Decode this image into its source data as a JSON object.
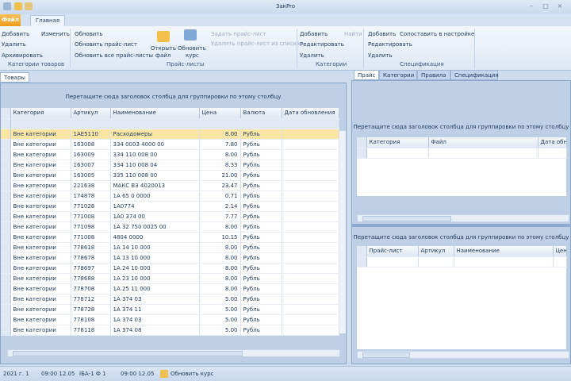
{
  "window": {
    "title": "ЗакPro"
  },
  "ribbon": {
    "app_button": "Файл",
    "tab": "Главная",
    "group1": {
      "items": [
        "Добавить",
        "Изменить",
        "Удалить",
        "Архивировать"
      ],
      "label": "Категории товаров"
    },
    "group2": {
      "items": [
        "Обновить",
        "Обновить прайс-лист",
        "Обновить все прайс-листы"
      ],
      "label": "Прайс-листы"
    },
    "group3": {
      "open": "Открыть",
      "open_sub": "файл",
      "refresh": "Обновить",
      "refresh_sub": "курс",
      "dis1": "Задать прайс-лист",
      "dis2": "Удалить прайс-лист из списка",
      "label": "Прайс-листы"
    },
    "group4": {
      "items": [
        "Добавить",
        "Редактировать",
        "Удалить"
      ],
      "extra": "Найти",
      "label": "Категории"
    },
    "group5": {
      "items": [
        "Добавить",
        "Редактировать",
        "Удалить"
      ],
      "extra": "Сопоставить в настройке",
      "label": "Спецификация"
    }
  },
  "left_panel": {
    "tab": "Товары",
    "group_hint": "Перетащите сюда заголовок столбца для группировки по этому столбцу",
    "columns": [
      "Категория",
      "Артикул",
      "Наименование",
      "Цена",
      "Валюта",
      "Дата обновления"
    ],
    "rows": [
      [
        "Вне категории",
        "1АЕ5110",
        "Расходомеры",
        "8.00",
        "Рубль",
        ""
      ],
      [
        "Вне категории",
        "163008",
        "334 0003 4000 00",
        "7.80",
        "Рубль",
        ""
      ],
      [
        "Вне категории",
        "163009",
        "334 110 008 00",
        "8.00",
        "Рубль",
        ""
      ],
      [
        "Вне категории",
        "163007",
        "334 110 008 04",
        "8.33",
        "Рубль",
        ""
      ],
      [
        "Вне категории",
        "163005",
        "335 110 008 00",
        "21.00",
        "Рубль",
        ""
      ],
      [
        "Вне категории",
        "221638",
        "МАКС ВЗ 4020013",
        "23.47",
        "Рубль",
        ""
      ],
      [
        "Вне категории",
        "174878",
        "1А 65 0 0000",
        "0.71",
        "Рубль",
        ""
      ],
      [
        "Вне категории",
        "771028",
        "1А0774",
        "2.14",
        "Рубль",
        ""
      ],
      [
        "Вне категории",
        "771008",
        "1А0 374 00",
        "7.77",
        "Рубль",
        ""
      ],
      [
        "Вне категории",
        "771098",
        "1А 32 750 0025 00",
        "8.00",
        "Рубль",
        ""
      ],
      [
        "Вне категории",
        "771008",
        "4804 0000",
        "10.15",
        "Рубль",
        ""
      ],
      [
        "Вне категории",
        "778618",
        "1А 14 10 000",
        "8.00",
        "Рубль",
        ""
      ],
      [
        "Вне категории",
        "778678",
        "1А 13 10 000",
        "8.00",
        "Рубль",
        ""
      ],
      [
        "Вне категории",
        "778697",
        "1А 24 10 000",
        "8.00",
        "Рубль",
        ""
      ],
      [
        "Вне категории",
        "778688",
        "1А 23 10 000",
        "8.00",
        "Рубль",
        ""
      ],
      [
        "Вне категории",
        "778708",
        "1А 25 11 000",
        "8.00",
        "Рубль",
        ""
      ],
      [
        "Вне категории",
        "778712",
        "1А 374 03",
        "5.00",
        "Рубль",
        ""
      ],
      [
        "Вне категории",
        "778728",
        "1А 374 11",
        "5.00",
        "Рубль",
        ""
      ],
      [
        "Вне категории",
        "778108",
        "1А 374 03",
        "5.00",
        "Рубль",
        ""
      ],
      [
        "Вне категории",
        "778118",
        "1А 374 08",
        "5.00",
        "Рубль",
        ""
      ]
    ]
  },
  "right_panel": {
    "tabs": [
      "Прайс",
      "Категории",
      "Правила",
      "Спецификация"
    ],
    "top": {
      "group_hint": "Перетащите сюда заголовок столбца для группировки по этому столбцу",
      "columns": [
        "Категория",
        "Файл",
        "Дата обн."
      ]
    },
    "bottom": {
      "group_hint": "Перетащите сюда заголовок столбца для группировки по этому столбцу",
      "columns": [
        "Прайс-лист",
        "Артикул",
        "Наименование",
        "Цена"
      ]
    }
  },
  "status": {
    "items": [
      "2021 г. 1",
      "09:00 12.05",
      "IБА-1 Ф 1",
      "09:00 12.05"
    ],
    "refresh": "Обновить курс"
  }
}
